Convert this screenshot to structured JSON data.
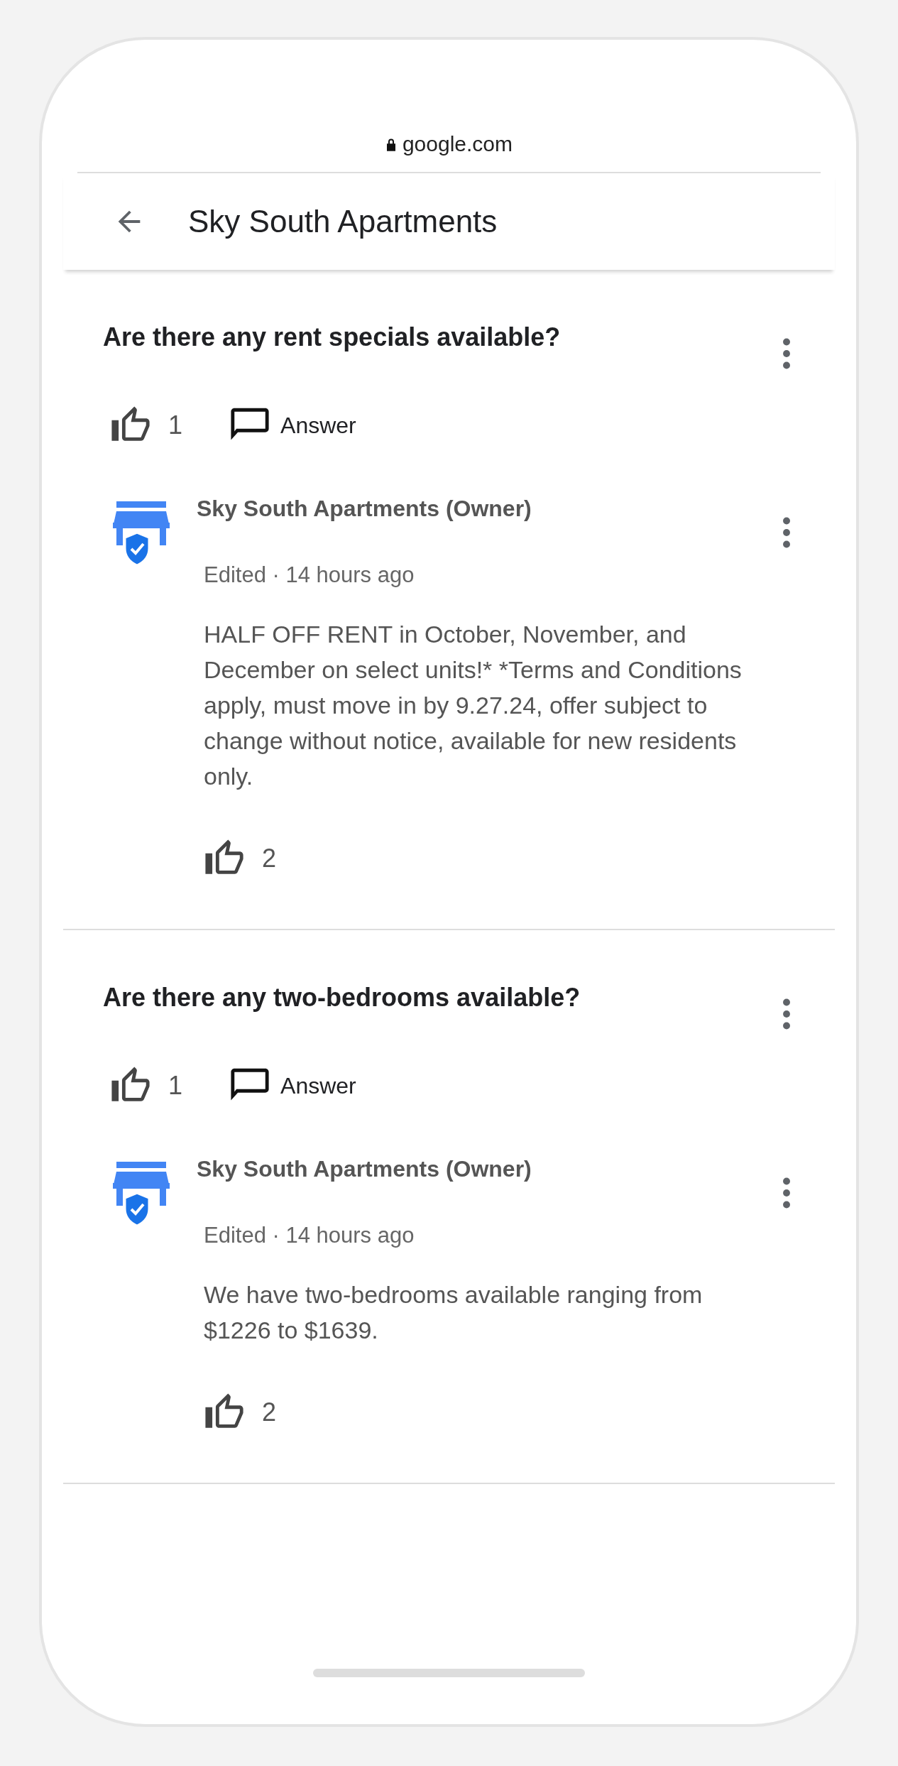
{
  "browser": {
    "url": "google.com"
  },
  "header": {
    "title": "Sky South Apartments"
  },
  "questions": [
    {
      "text": "Are there any rent specials available?",
      "likes": "1",
      "answer_label": "Answer",
      "answers": [
        {
          "author": "Sky South Apartments (Owner)",
          "meta": "Edited · 14 hours ago",
          "body": "HALF OFF RENT in October, November, and December on select units!* *Terms and Conditions apply, must move in by 9.27.24, offer subject to change without notice, available for new residents only.",
          "likes": "2"
        }
      ]
    },
    {
      "text": "Are there any two-bedrooms available?",
      "likes": "1",
      "answer_label": "Answer",
      "answers": [
        {
          "author": "Sky South Apartments (Owner)",
          "meta": "Edited · 14 hours ago",
          "body": "We have two-bedrooms available ranging from $1226 to $1639.",
          "likes": "2"
        }
      ]
    }
  ]
}
